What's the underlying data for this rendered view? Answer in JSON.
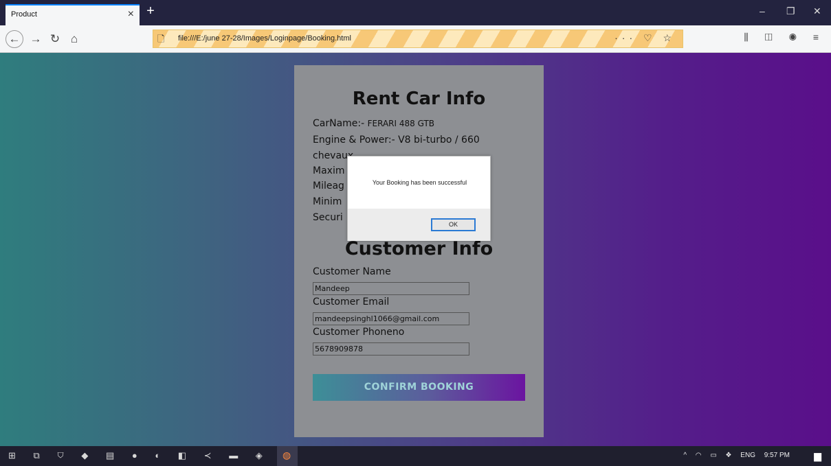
{
  "browser": {
    "tab_title": "Product",
    "tab_close": "×",
    "new_tab": "+",
    "url": "file:///E:/june 27-28/Images/Loginpage/Booking.html",
    "window": {
      "minimize": "–",
      "restore": "❐",
      "close": "✕"
    },
    "nav": {
      "back": "←",
      "forward": "→",
      "reload": "↻",
      "home": "⌂"
    },
    "url_actions": "··· ♡ ☆",
    "toolbar_icons": "⫼ ◫ ◉ ≡"
  },
  "car_info": {
    "title": "Rent Car Info",
    "lines": [
      {
        "label": "CarName:-",
        "value": "FERARI 488 GTB"
      },
      {
        "label": "Engine & Power:-",
        "value": "V8 bi-turbo / 660"
      },
      {
        "label": "chevaux",
        "value": ""
      },
      {
        "label": "Maxim",
        "value": ""
      },
      {
        "label": "Mileag",
        "value": ""
      },
      {
        "label": "Minim",
        "value": ""
      },
      {
        "label": "Securi",
        "value": ""
      }
    ]
  },
  "customer_info": {
    "title": "Customer Info",
    "name_label": "Customer Name",
    "name_value": "Mandeep",
    "email_label": "Customer Email",
    "email_value": "mandeepsinghl1066@gmail.com",
    "phone_label": "Customer Phoneno",
    "phone_value": "5678909878"
  },
  "confirm_label": "CONFIRM BOOKING",
  "dialog": {
    "message": "Your Booking has been successful",
    "ok_label": "OK"
  },
  "taskbar": {
    "icons": "⊞ ⧉ ⛉ ◆ ▤ ● ◐ ◧ ≺ ▬ ◈ ▣",
    "active_icon": "◍",
    "tray": {
      "chevron": "^",
      "lang": "ENG",
      "time": "9:57 PM"
    },
    "notification_icon": "▆"
  }
}
